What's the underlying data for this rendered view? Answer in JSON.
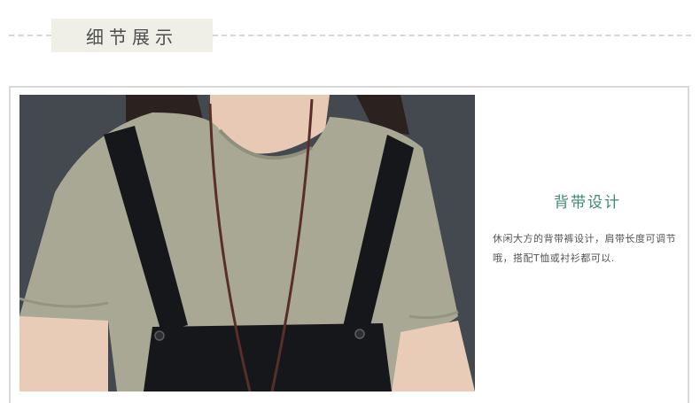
{
  "header": {
    "section_title": "细节展示"
  },
  "photo": {
    "subject": "model-wearing-tshirt-and-overalls"
  },
  "feature": {
    "title": "背带设计",
    "description": "休闲大方的背带裤设计，肩带长度可调节哦，搭配T恤或衬衫都可以."
  },
  "colors": {
    "accent": "#3c8a70",
    "title_tag_bg": "#efefe8",
    "frame": "#d9d9d9"
  }
}
